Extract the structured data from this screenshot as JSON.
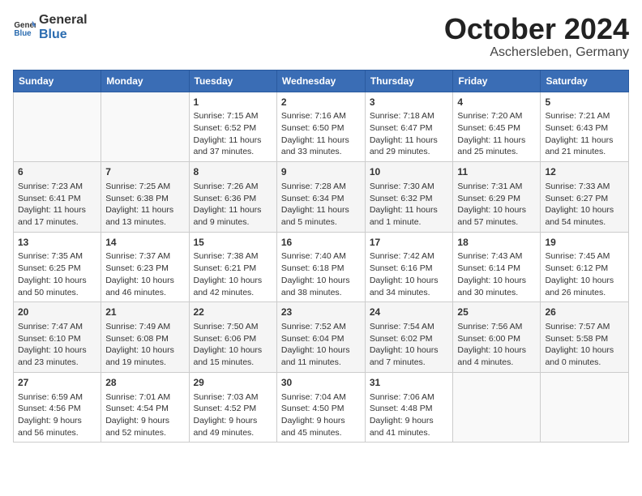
{
  "header": {
    "logo_general": "General",
    "logo_blue": "Blue",
    "month": "October 2024",
    "location": "Aschersleben, Germany"
  },
  "weekdays": [
    "Sunday",
    "Monday",
    "Tuesday",
    "Wednesday",
    "Thursday",
    "Friday",
    "Saturday"
  ],
  "weeks": [
    [
      {
        "day": "",
        "content": ""
      },
      {
        "day": "",
        "content": ""
      },
      {
        "day": "1",
        "content": "Sunrise: 7:15 AM\nSunset: 6:52 PM\nDaylight: 11 hours\nand 37 minutes."
      },
      {
        "day": "2",
        "content": "Sunrise: 7:16 AM\nSunset: 6:50 PM\nDaylight: 11 hours\nand 33 minutes."
      },
      {
        "day": "3",
        "content": "Sunrise: 7:18 AM\nSunset: 6:47 PM\nDaylight: 11 hours\nand 29 minutes."
      },
      {
        "day": "4",
        "content": "Sunrise: 7:20 AM\nSunset: 6:45 PM\nDaylight: 11 hours\nand 25 minutes."
      },
      {
        "day": "5",
        "content": "Sunrise: 7:21 AM\nSunset: 6:43 PM\nDaylight: 11 hours\nand 21 minutes."
      }
    ],
    [
      {
        "day": "6",
        "content": "Sunrise: 7:23 AM\nSunset: 6:41 PM\nDaylight: 11 hours\nand 17 minutes."
      },
      {
        "day": "7",
        "content": "Sunrise: 7:25 AM\nSunset: 6:38 PM\nDaylight: 11 hours\nand 13 minutes."
      },
      {
        "day": "8",
        "content": "Sunrise: 7:26 AM\nSunset: 6:36 PM\nDaylight: 11 hours\nand 9 minutes."
      },
      {
        "day": "9",
        "content": "Sunrise: 7:28 AM\nSunset: 6:34 PM\nDaylight: 11 hours\nand 5 minutes."
      },
      {
        "day": "10",
        "content": "Sunrise: 7:30 AM\nSunset: 6:32 PM\nDaylight: 11 hours\nand 1 minute."
      },
      {
        "day": "11",
        "content": "Sunrise: 7:31 AM\nSunset: 6:29 PM\nDaylight: 10 hours\nand 57 minutes."
      },
      {
        "day": "12",
        "content": "Sunrise: 7:33 AM\nSunset: 6:27 PM\nDaylight: 10 hours\nand 54 minutes."
      }
    ],
    [
      {
        "day": "13",
        "content": "Sunrise: 7:35 AM\nSunset: 6:25 PM\nDaylight: 10 hours\nand 50 minutes."
      },
      {
        "day": "14",
        "content": "Sunrise: 7:37 AM\nSunset: 6:23 PM\nDaylight: 10 hours\nand 46 minutes."
      },
      {
        "day": "15",
        "content": "Sunrise: 7:38 AM\nSunset: 6:21 PM\nDaylight: 10 hours\nand 42 minutes."
      },
      {
        "day": "16",
        "content": "Sunrise: 7:40 AM\nSunset: 6:18 PM\nDaylight: 10 hours\nand 38 minutes."
      },
      {
        "day": "17",
        "content": "Sunrise: 7:42 AM\nSunset: 6:16 PM\nDaylight: 10 hours\nand 34 minutes."
      },
      {
        "day": "18",
        "content": "Sunrise: 7:43 AM\nSunset: 6:14 PM\nDaylight: 10 hours\nand 30 minutes."
      },
      {
        "day": "19",
        "content": "Sunrise: 7:45 AM\nSunset: 6:12 PM\nDaylight: 10 hours\nand 26 minutes."
      }
    ],
    [
      {
        "day": "20",
        "content": "Sunrise: 7:47 AM\nSunset: 6:10 PM\nDaylight: 10 hours\nand 23 minutes."
      },
      {
        "day": "21",
        "content": "Sunrise: 7:49 AM\nSunset: 6:08 PM\nDaylight: 10 hours\nand 19 minutes."
      },
      {
        "day": "22",
        "content": "Sunrise: 7:50 AM\nSunset: 6:06 PM\nDaylight: 10 hours\nand 15 minutes."
      },
      {
        "day": "23",
        "content": "Sunrise: 7:52 AM\nSunset: 6:04 PM\nDaylight: 10 hours\nand 11 minutes."
      },
      {
        "day": "24",
        "content": "Sunrise: 7:54 AM\nSunset: 6:02 PM\nDaylight: 10 hours\nand 7 minutes."
      },
      {
        "day": "25",
        "content": "Sunrise: 7:56 AM\nSunset: 6:00 PM\nDaylight: 10 hours\nand 4 minutes."
      },
      {
        "day": "26",
        "content": "Sunrise: 7:57 AM\nSunset: 5:58 PM\nDaylight: 10 hours\nand 0 minutes."
      }
    ],
    [
      {
        "day": "27",
        "content": "Sunrise: 6:59 AM\nSunset: 4:56 PM\nDaylight: 9 hours\nand 56 minutes."
      },
      {
        "day": "28",
        "content": "Sunrise: 7:01 AM\nSunset: 4:54 PM\nDaylight: 9 hours\nand 52 minutes."
      },
      {
        "day": "29",
        "content": "Sunrise: 7:03 AM\nSunset: 4:52 PM\nDaylight: 9 hours\nand 49 minutes."
      },
      {
        "day": "30",
        "content": "Sunrise: 7:04 AM\nSunset: 4:50 PM\nDaylight: 9 hours\nand 45 minutes."
      },
      {
        "day": "31",
        "content": "Sunrise: 7:06 AM\nSunset: 4:48 PM\nDaylight: 9 hours\nand 41 minutes."
      },
      {
        "day": "",
        "content": ""
      },
      {
        "day": "",
        "content": ""
      }
    ]
  ]
}
